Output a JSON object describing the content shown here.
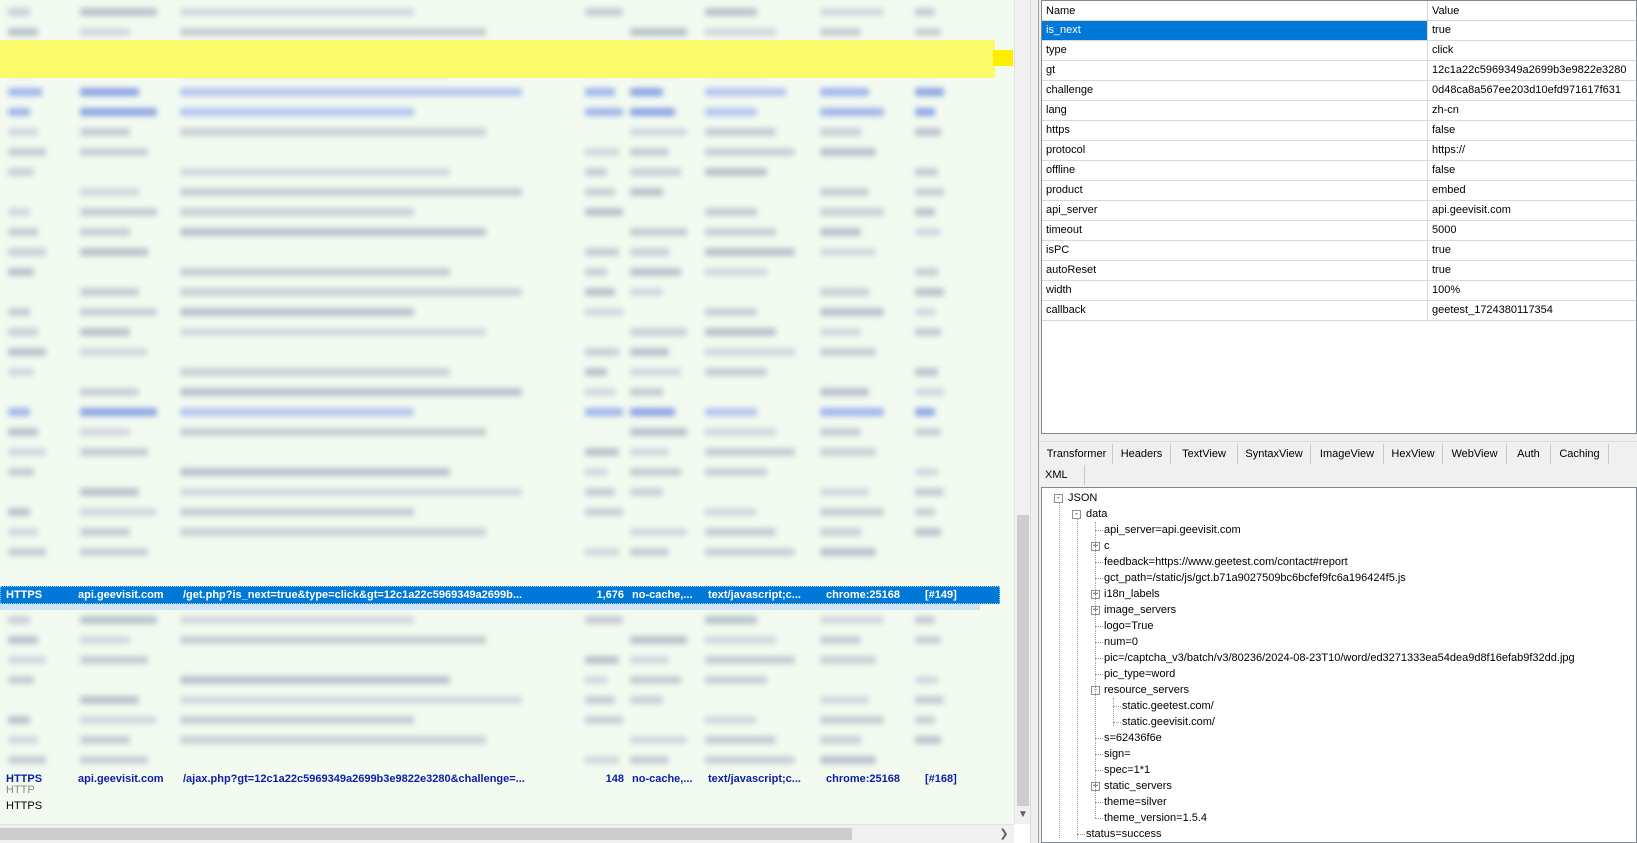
{
  "session_list": {
    "selected_row": {
      "protocol": "HTTPS",
      "host": "api.geevisit.com",
      "url": "/get.php?is_next=true&type=click&gt=12c1a22c5969349a2699b...",
      "size": "1,676",
      "caching": "no-cache,...",
      "content_type": "text/javascript;c...",
      "process": "chrome:25168",
      "id": "[#149]"
    },
    "highlighted_row": {
      "protocol": "HTTPS",
      "host": "api.geevisit.com",
      "url": "/ajax.php?gt=12c1a22c5969349a2699b3e9822e3280&challenge=...",
      "size": "148",
      "caching": "no-cache,...",
      "content_type": "text/javascript;c...",
      "process": "chrome:25168",
      "id": "[#168]"
    },
    "plain_rows": [
      "HTTP",
      "HTTPS"
    ],
    "colors": {
      "selection": "#0078d7",
      "row_highlight": "#fbfa6a",
      "link_text": "#0a1ea6",
      "background": "#f3fbf1"
    }
  },
  "query_grid": {
    "columns": [
      "Name",
      "Value"
    ],
    "rows": [
      {
        "name": "is_next",
        "value": "true"
      },
      {
        "name": "type",
        "value": "click"
      },
      {
        "name": "gt",
        "value": "12c1a22c5969349a2699b3e9822e3280"
      },
      {
        "name": "challenge",
        "value": "0d48ca8a567ee203d10efd971617f631"
      },
      {
        "name": "lang",
        "value": "zh-cn"
      },
      {
        "name": "https",
        "value": "false"
      },
      {
        "name": "protocol",
        "value": "https://"
      },
      {
        "name": "offline",
        "value": "false"
      },
      {
        "name": "product",
        "value": "embed"
      },
      {
        "name": "api_server",
        "value": "api.geevisit.com"
      },
      {
        "name": "timeout",
        "value": "5000"
      },
      {
        "name": "isPC",
        "value": "true"
      },
      {
        "name": "autoReset",
        "value": "true"
      },
      {
        "name": "width",
        "value": "100%"
      },
      {
        "name": "callback",
        "value": "geetest_1724380117354"
      }
    ]
  },
  "inspector_tabs": {
    "row1": [
      "Transformer",
      "Headers",
      "TextView",
      "SyntaxView",
      "ImageView",
      "HexView",
      "WebView",
      "Auth",
      "Caching"
    ],
    "row2": [
      "XML"
    ]
  },
  "json_tree": {
    "root": "JSON",
    "data": "data",
    "children": [
      {
        "label": "api_server=api.geevisit.com",
        "expand": ""
      },
      {
        "label": "c",
        "expand": "+"
      },
      {
        "label": "feedback=https://www.geetest.com/contact#report",
        "expand": ""
      },
      {
        "label": "gct_path=/static/js/gct.b71a9027509bc6bcfef9fc6a196424f5.js",
        "expand": ""
      },
      {
        "label": "i18n_labels",
        "expand": "+"
      },
      {
        "label": "image_servers",
        "expand": "+"
      },
      {
        "label": "logo=True",
        "expand": ""
      },
      {
        "label": "num=0",
        "expand": ""
      },
      {
        "label": "pic=/captcha_v3/batch/v3/80236/2024-08-23T10/word/ed3271333ea54dea9d8f16efab9f32dd.jpg",
        "expand": ""
      },
      {
        "label": "pic_type=word",
        "expand": ""
      },
      {
        "label": "resource_servers",
        "expand": "-"
      },
      {
        "label": "static.geetest.com/",
        "expand": "",
        "nested": true
      },
      {
        "label": "static.geevisit.com/",
        "expand": "",
        "nested": true
      },
      {
        "label": "s=62436f6e",
        "expand": ""
      },
      {
        "label": "sign=",
        "expand": ""
      },
      {
        "label": "spec=1*1",
        "expand": ""
      },
      {
        "label": "static_servers",
        "expand": "+"
      },
      {
        "label": "theme=silver",
        "expand": ""
      },
      {
        "label": "theme_version=1.5.4",
        "expand": ""
      }
    ],
    "status": "status=success"
  }
}
